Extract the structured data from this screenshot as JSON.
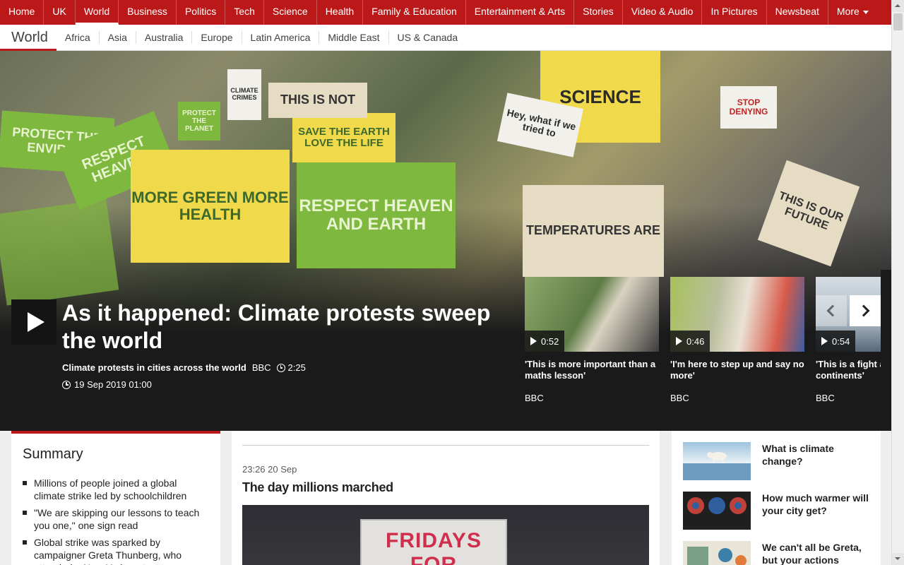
{
  "topnav": {
    "items": [
      "Home",
      "UK",
      "World",
      "Business",
      "Politics",
      "Tech",
      "Science",
      "Health",
      "Family & Education",
      "Entertainment & Arts",
      "Stories",
      "Video & Audio",
      "In Pictures",
      "Newsbeat",
      "More"
    ],
    "active": "World"
  },
  "subnav": {
    "title": "World",
    "items": [
      "Africa",
      "Asia",
      "Australia",
      "Europe",
      "Latin America",
      "Middle East",
      "US & Canada"
    ]
  },
  "hero": {
    "title": "As it happened: Climate protests sweep the world",
    "subtitle": "Climate protests in cities across the world",
    "source": "BBC",
    "duration": "2:25",
    "date": "19 Sep 2019 01:00",
    "signs": {
      "protect_the_environment": "PROTECT THE ENVIRON",
      "respect_heaven": "RESPECT HEAVEN",
      "more_green": "MORE GREEN MORE HEALTH",
      "save_the_earth": "SAVE THE EARTH LOVE THE LIFE",
      "respect_heaven_earth": "RESPECT HEAVEN AND EARTH",
      "this_is_not": "THIS IS NOT",
      "temperatures": "TEMPERATURES ARE",
      "science": "SCIENCE",
      "this_is_our_future": "THIS IS OUR FUTURE",
      "stop_denying": "STOP DENYING",
      "what_if": "Hey, what if we tried to",
      "protect_the_planet": "PROTECT THE PLANET",
      "climate_crimes": "CLIMATE CRIMES"
    }
  },
  "video_cards": [
    {
      "duration": "0:52",
      "title": "'This is more important than a maths lesson'",
      "source": "BBC",
      "thumb_color": "#6b8f4e"
    },
    {
      "duration": "0:46",
      "title": "'I'm here to step up and say no more'",
      "source": "BBC",
      "thumb_color": "#9bb05a"
    },
    {
      "duration": "0:54",
      "title": "'This is a fight across continents'",
      "source": "BBC",
      "thumb_color": "#7a8a99"
    }
  ],
  "summary": {
    "heading": "Summary",
    "items": [
      "Millions of people joined a global climate strike led by schoolchildren",
      "\"We are skipping our lessons to teach you one,\" one sign read",
      "Global strike was sparked by campaigner Greta Thunberg, who attended a New York protest"
    ]
  },
  "live": {
    "time": "23:26 20 Sep",
    "headline": "The day millions marched",
    "sign_text": "FRIDAYS FOR"
  },
  "related": [
    {
      "title": "What is climate change?",
      "thumb": "polar-bear"
    },
    {
      "title": "How much warmer will your city get?",
      "thumb": "globes"
    },
    {
      "title": "We can't all be Greta, but your actions",
      "thumb": "illustration"
    }
  ],
  "colors": {
    "brand_red": "#bb1919",
    "hero_bg": "#1a1a1a"
  }
}
